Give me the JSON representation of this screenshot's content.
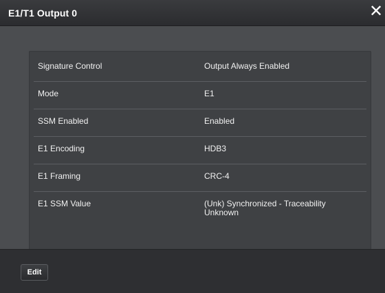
{
  "dialog": {
    "title": "E1/T1 Output 0",
    "close_icon": "close-icon",
    "close_label": "✕"
  },
  "properties": [
    {
      "label": "Signature Control",
      "value": "Output Always Enabled"
    },
    {
      "label": "Mode",
      "value": "E1"
    },
    {
      "label": "SSM Enabled",
      "value": "Enabled"
    },
    {
      "label": "E1 Encoding",
      "value": "HDB3"
    },
    {
      "label": "E1 Framing",
      "value": "CRC-4"
    },
    {
      "label": "E1 SSM Value",
      "value": "(Unk) Synchronized - Traceability Unknown"
    }
  ],
  "footer": {
    "edit_label": "Edit"
  },
  "colors": {
    "dialog_bg": "#4a4c4f",
    "panel_bg": "#3f4144",
    "footer_bg": "#2e2f32",
    "text": "#f2f2f2"
  }
}
